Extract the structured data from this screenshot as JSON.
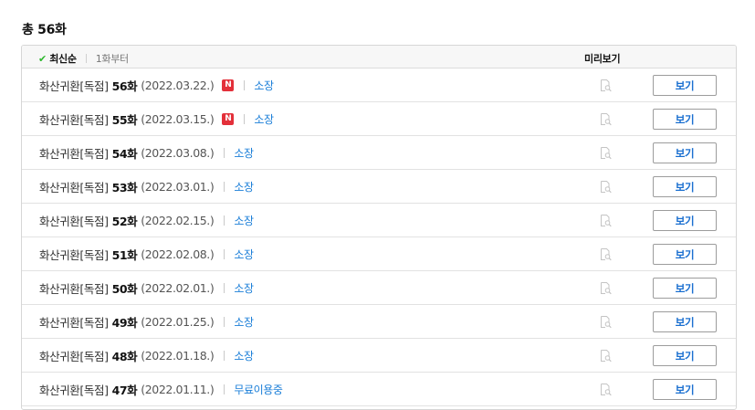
{
  "header": {
    "total_label": "총 56화"
  },
  "sort": {
    "active_label": "최신순",
    "other_label": "1화부터",
    "preview_header": "미리보기"
  },
  "colors": {
    "accent": "#1a7ed8",
    "new_badge": "#e3303a",
    "check": "#2eb82e"
  },
  "episodes": [
    {
      "series": "화산귀환[독점]",
      "episode": "56화",
      "date": "(2022.03.22.)",
      "is_new": true,
      "new_label": "N",
      "status": "소장",
      "preview_icon": "preview-search-icon",
      "button": "보기"
    },
    {
      "series": "화산귀환[독점]",
      "episode": "55화",
      "date": "(2022.03.15.)",
      "is_new": true,
      "new_label": "N",
      "status": "소장",
      "preview_icon": "preview-search-icon",
      "button": "보기"
    },
    {
      "series": "화산귀환[독점]",
      "episode": "54화",
      "date": "(2022.03.08.)",
      "is_new": false,
      "status": "소장",
      "preview_icon": "preview-search-icon",
      "button": "보기"
    },
    {
      "series": "화산귀환[독점]",
      "episode": "53화",
      "date": "(2022.03.01.)",
      "is_new": false,
      "status": "소장",
      "preview_icon": "preview-search-icon",
      "button": "보기"
    },
    {
      "series": "화산귀환[독점]",
      "episode": "52화",
      "date": "(2022.02.15.)",
      "is_new": false,
      "status": "소장",
      "preview_icon": "preview-search-icon",
      "button": "보기"
    },
    {
      "series": "화산귀환[독점]",
      "episode": "51화",
      "date": "(2022.02.08.)",
      "is_new": false,
      "status": "소장",
      "preview_icon": "preview-search-icon",
      "button": "보기"
    },
    {
      "series": "화산귀환[독점]",
      "episode": "50화",
      "date": "(2022.02.01.)",
      "is_new": false,
      "status": "소장",
      "preview_icon": "preview-search-icon",
      "button": "보기"
    },
    {
      "series": "화산귀환[독점]",
      "episode": "49화",
      "date": "(2022.01.25.)",
      "is_new": false,
      "status": "소장",
      "preview_icon": "preview-search-icon",
      "button": "보기"
    },
    {
      "series": "화산귀환[독점]",
      "episode": "48화",
      "date": "(2022.01.18.)",
      "is_new": false,
      "status": "소장",
      "preview_icon": "preview-search-icon",
      "button": "보기"
    },
    {
      "series": "화산귀환[독점]",
      "episode": "47화",
      "date": "(2022.01.11.)",
      "is_new": false,
      "status": "무료이용중",
      "preview_icon": "preview-search-icon",
      "button": "보기"
    }
  ]
}
